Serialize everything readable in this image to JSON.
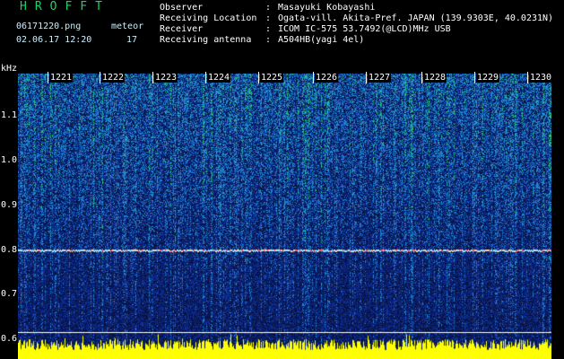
{
  "header": {
    "app_title": "HROFFT",
    "file_name": "06171220.png",
    "date_time": "02.06.17 12:20",
    "meteor_label": "meteor",
    "meteor_count": "17"
  },
  "station_info": [
    {
      "label": "Observer",
      "value": "Masayuki Kobayashi"
    },
    {
      "label": "Receiving Location",
      "value": "Ogata-vill. Akita-Pref. JAPAN (139.9303E, 40.0231N)"
    },
    {
      "label": "Receiver",
      "value": "ICOM IC-575 53.7492(@LCD)MHz USB"
    },
    {
      "label": "Receiving antenna",
      "value": "A504HB(yagi 4el)"
    }
  ],
  "axis": {
    "y_unit": "kHz",
    "y_ticks": [
      "1.1",
      "1.0",
      "0.9",
      "0.8",
      "0.7",
      "0.6"
    ],
    "time_ticks": [
      "1221",
      "1222",
      "1223",
      "1224",
      "1225",
      "1226",
      "1227",
      "1228",
      "1229",
      "1230"
    ]
  },
  "spectrogram": {
    "carrier_khz": 0.79,
    "colors": {
      "background": "#071445",
      "noise": "#1b4fd6",
      "hot": "#26d46e",
      "carrier": "#ff5a5a",
      "level": "#ffff00"
    }
  }
}
